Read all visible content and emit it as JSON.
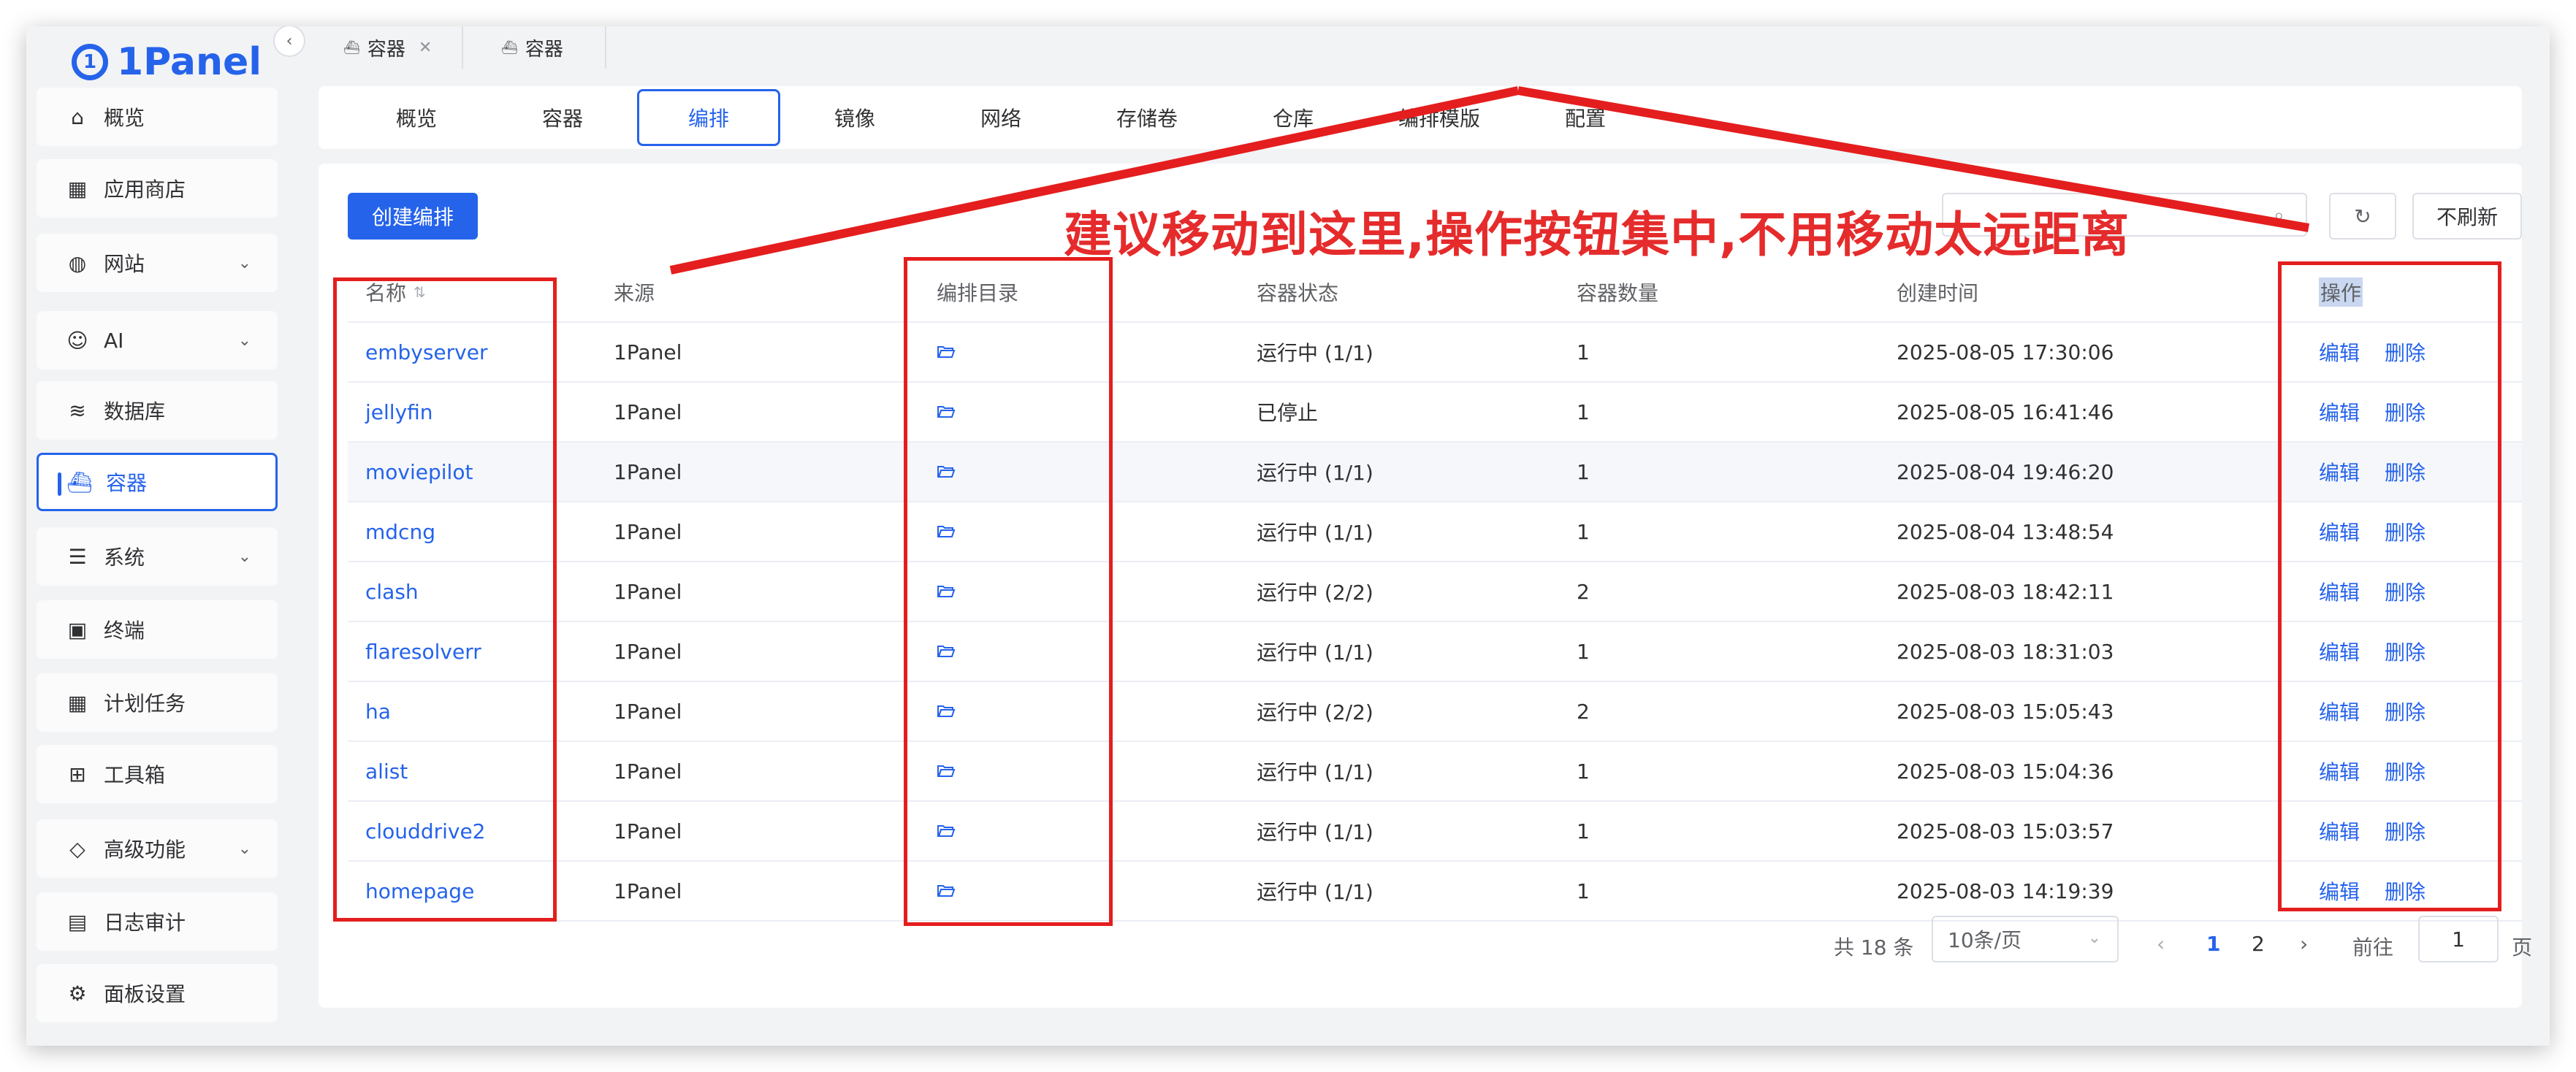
{
  "brand": {
    "name": "1Panel"
  },
  "colors": {
    "accent": "#2563eb",
    "annotation": "#e41e1e",
    "page_bg": "#f2f3f5"
  },
  "sidebar": {
    "items": [
      {
        "label": "概览",
        "icon": "home-icon",
        "expandable": false,
        "active": false
      },
      {
        "label": "应用商店",
        "icon": "grid-icon",
        "expandable": false,
        "active": false
      },
      {
        "label": "网站",
        "icon": "globe-icon",
        "expandable": true,
        "active": false
      },
      {
        "label": "AI",
        "icon": "robot-icon",
        "expandable": true,
        "active": false
      },
      {
        "label": "数据库",
        "icon": "layers-icon",
        "expandable": false,
        "active": false
      },
      {
        "label": "容器",
        "icon": "docker-icon",
        "expandable": false,
        "active": true
      },
      {
        "label": "系统",
        "icon": "server-icon",
        "expandable": true,
        "active": false
      },
      {
        "label": "终端",
        "icon": "terminal-icon",
        "expandable": false,
        "active": false
      },
      {
        "label": "计划任务",
        "icon": "calendar-icon",
        "expandable": false,
        "active": false
      },
      {
        "label": "工具箱",
        "icon": "toolbox-icon",
        "expandable": false,
        "active": false
      },
      {
        "label": "高级功能",
        "icon": "diamond-icon",
        "expandable": true,
        "active": false
      },
      {
        "label": "日志审计",
        "icon": "log-icon",
        "expandable": false,
        "active": false
      },
      {
        "label": "面板设置",
        "icon": "gear-icon",
        "expandable": false,
        "active": false
      }
    ]
  },
  "top_tabs": [
    {
      "label": "容器",
      "closable": true
    },
    {
      "label": "容器",
      "closable": false
    }
  ],
  "sub_tabs": {
    "items": [
      "概览",
      "容器",
      "编排",
      "镜像",
      "网络",
      "存储卷",
      "仓库",
      "编排模版",
      "配置"
    ],
    "active_index": 2
  },
  "toolbar": {
    "create_label": "创建编排",
    "search_placeholder": "",
    "no_refresh_label": "不刷新"
  },
  "table": {
    "headers": {
      "name": "名称",
      "source": "来源",
      "dir": "编排目录",
      "status": "容器状态",
      "count": "容器数量",
      "created": "创建时间",
      "ops": "操作"
    },
    "rows": [
      {
        "name": "embyserver",
        "source": "1Panel",
        "status": "运行中 (1/1)",
        "count": "1",
        "created": "2025-08-05 17:30:06"
      },
      {
        "name": "jellyfin",
        "source": "1Panel",
        "status": "已停止",
        "count": "1",
        "created": "2025-08-05 16:41:46"
      },
      {
        "name": "moviepilot",
        "source": "1Panel",
        "status": "运行中 (1/1)",
        "count": "1",
        "created": "2025-08-04 19:46:20"
      },
      {
        "name": "mdcng",
        "source": "1Panel",
        "status": "运行中 (1/1)",
        "count": "1",
        "created": "2025-08-04 13:48:54"
      },
      {
        "name": "clash",
        "source": "1Panel",
        "status": "运行中 (2/2)",
        "count": "2",
        "created": "2025-08-03 18:42:11"
      },
      {
        "name": "flaresolverr",
        "source": "1Panel",
        "status": "运行中 (1/1)",
        "count": "1",
        "created": "2025-08-03 18:31:03"
      },
      {
        "name": "ha",
        "source": "1Panel",
        "status": "运行中 (2/2)",
        "count": "2",
        "created": "2025-08-03 15:05:43"
      },
      {
        "name": "alist",
        "source": "1Panel",
        "status": "运行中 (1/1)",
        "count": "1",
        "created": "2025-08-03 15:04:36"
      },
      {
        "name": "clouddrive2",
        "source": "1Panel",
        "status": "运行中 (1/1)",
        "count": "1",
        "created": "2025-08-03 15:03:57"
      },
      {
        "name": "homepage",
        "source": "1Panel",
        "status": "运行中 (1/1)",
        "count": "1",
        "created": "2025-08-03 14:19:39"
      }
    ],
    "edit_label": "编辑",
    "delete_label": "删除"
  },
  "pagination": {
    "total_label": "共 18 条",
    "page_size": "10条/页",
    "pages": [
      "1",
      "2"
    ],
    "current": "1",
    "goto_label": "前往",
    "goto_value": "1",
    "page_suffix": "页"
  },
  "annotation": {
    "text": "建议移动到这里,操作按钮集中,不用移动太远距离"
  }
}
